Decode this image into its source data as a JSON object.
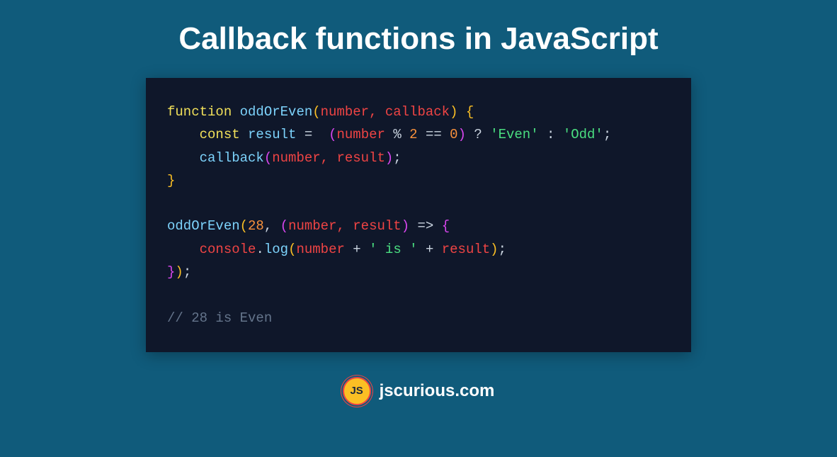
{
  "title": "Callback functions in JavaScript",
  "code": {
    "line1": {
      "kw": "function",
      "fn": "oddOrEven",
      "params": "number, callback",
      "open": "{"
    },
    "line2": {
      "kw": "const",
      "var": "result",
      "eq": "=",
      "lparen": "(",
      "number": "number",
      "mod": "%",
      "two": "2",
      "eqeq": "==",
      "zero": "0",
      "rparen": ")",
      "tern": "?",
      "even": "'Even'",
      "colon": ":",
      "odd": "'Odd'",
      "semi": ";"
    },
    "line3": {
      "call": "callback",
      "lparen": "(",
      "args": "number, result",
      "rparen": ")",
      "semi": ";"
    },
    "line4": {
      "close": "}"
    },
    "line6": {
      "fn": "oddOrEven",
      "lparen": "(",
      "num": "28",
      "comma": ", ",
      "lparen2": "(",
      "params": "number, result",
      "rparen2": ")",
      "arrow": "=>",
      "open": "{"
    },
    "line7": {
      "console": "console",
      "dot": ".",
      "log": "log",
      "lparen": "(",
      "number": "number",
      "plus1": "+",
      "is": "' is '",
      "plus2": "+",
      "result": "result",
      "rparen": ")",
      "semi": ";"
    },
    "line8": {
      "close": "}",
      "rparen": ")",
      "semi": ";"
    },
    "comment": "// 28 is Even"
  },
  "footer": {
    "logo": "JS",
    "site": "jscurious.com"
  }
}
